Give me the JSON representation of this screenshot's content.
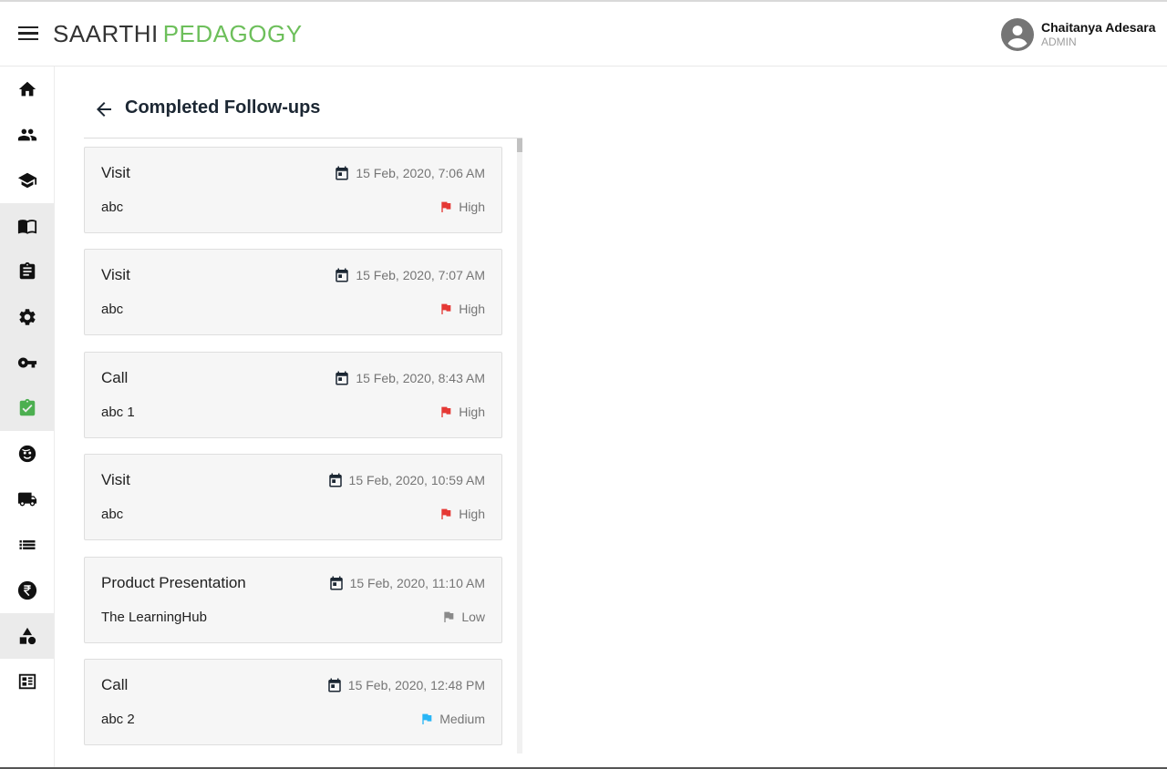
{
  "header": {
    "brand_part1": "SAARTHI",
    "brand_part2": "PEDAGOGY",
    "user_name": "Chaitanya Adesara",
    "user_role": "ADMIN"
  },
  "sidebar": {
    "items": [
      {
        "icon": "home-icon"
      },
      {
        "icon": "people-icon"
      },
      {
        "icon": "school-icon"
      },
      {
        "icon": "book-icon"
      },
      {
        "icon": "assignment-icon"
      },
      {
        "icon": "settings-icon"
      },
      {
        "icon": "key-icon"
      },
      {
        "icon": "assignment-check-icon",
        "active_color": "#4caf50"
      },
      {
        "icon": "face-icon"
      },
      {
        "icon": "truck-icon"
      },
      {
        "icon": "list-icon"
      },
      {
        "icon": "rupee-icon"
      },
      {
        "icon": "category-icon"
      },
      {
        "icon": "calendar-view-icon"
      }
    ]
  },
  "main": {
    "title": "Completed Follow-ups",
    "followups": [
      {
        "type": "Visit",
        "date": "15 Feb, 2020, 7:06 AM",
        "description": "abc",
        "priority": "High",
        "priority_color": "#e53935"
      },
      {
        "type": "Visit",
        "date": "15 Feb, 2020, 7:07 AM",
        "description": "abc",
        "priority": "High",
        "priority_color": "#e53935"
      },
      {
        "type": "Call",
        "date": "15 Feb, 2020, 8:43 AM",
        "description": "abc 1",
        "priority": "High",
        "priority_color": "#e53935"
      },
      {
        "type": "Visit",
        "date": "15 Feb, 2020, 10:59 AM",
        "description": "abc",
        "priority": "High",
        "priority_color": "#e53935"
      },
      {
        "type": "Product Presentation",
        "date": "15 Feb, 2020, 11:10 AM",
        "description": "The LearningHub",
        "priority": "Low",
        "priority_color": "#8a8a8a"
      },
      {
        "type": "Call",
        "date": "15 Feb, 2020, 12:48 PM",
        "description": "abc 2",
        "priority": "Medium",
        "priority_color": "#29b6f6"
      }
    ]
  },
  "colors": {
    "brand_dark": "#333333",
    "brand_green": "#6dbf5b",
    "active_icon": "#4caf50"
  }
}
